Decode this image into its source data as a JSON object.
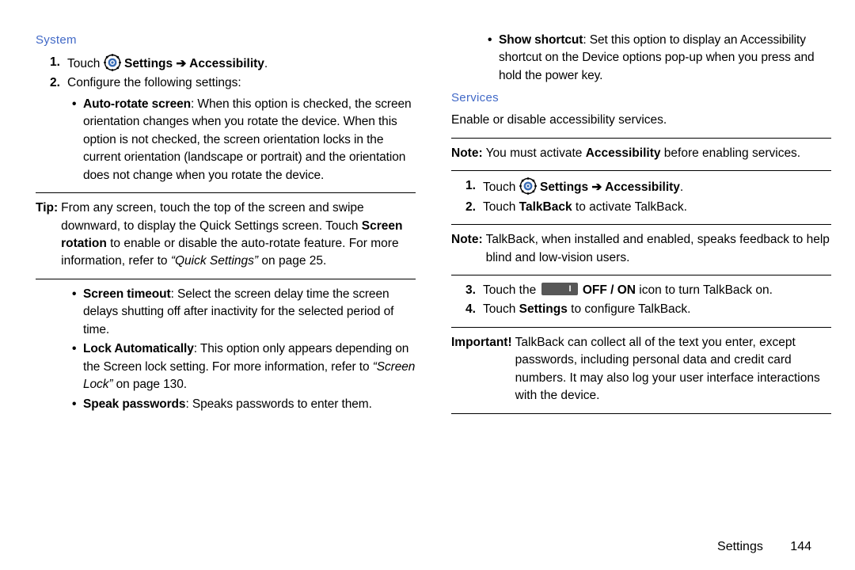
{
  "left": {
    "heading": "System",
    "step1_prefix": "Touch ",
    "step1_suffix": " Settings ➔ Accessibility",
    "step2": "Configure the following settings:",
    "auto_rotate_label": "Auto-rotate screen",
    "auto_rotate_text": ": When this option is checked, the screen orientation changes when you rotate the device. When this option is not checked, the screen orientation locks in the current orientation (landscape or portrait) and the orientation does not change when you rotate the device.",
    "tip_label": "Tip:",
    "tip_text1": " From any screen, touch the top of the screen and swipe downward, to display the Quick Settings screen. Touch ",
    "tip_bold": "Screen rotation",
    "tip_text2": " to enable or disable the auto-rotate feature. For more information, refer to ",
    "tip_italic": "“Quick Settings”",
    "tip_text3": " on page 25.",
    "screen_timeout_label": "Screen timeout",
    "screen_timeout_text": ": Select the screen delay time the screen delays shutting off after inactivity for the selected period of time.",
    "lock_auto_label": "Lock Automatically",
    "lock_auto_text": ": This option only appears depending on the Screen lock setting. For more information, refer to ",
    "lock_auto_italic": "“Screen Lock”",
    "lock_auto_text2": " on page 130.",
    "speak_pw_label": "Speak passwords",
    "speak_pw_text": ": Speaks passwords to enter them."
  },
  "right": {
    "show_shortcut_label": "Show shortcut",
    "show_shortcut_text": ": Set this option to display an Accessibility shortcut on the Device options pop-up when you press and hold the power key.",
    "heading": "Services",
    "intro": "Enable or disable accessibility services.",
    "note1_label": "Note:",
    "note1_text1": " You must activate ",
    "note1_bold": "Accessibility",
    "note1_text2": " before enabling services.",
    "step1_prefix": "Touch ",
    "step1_suffix": " Settings ➔ Accessibility",
    "step2_prefix": "Touch ",
    "step2_bold": "TalkBack",
    "step2_suffix": " to activate TalkBack.",
    "note2_label": "Note:",
    "note2_text": " TalkBack, when installed and enabled, speaks feedback to help blind and low-vision users.",
    "step3_prefix": "Touch the ",
    "step3_bold": " OFF / ON",
    "step3_suffix": " icon to turn TalkBack on.",
    "step4_prefix": "Touch ",
    "step4_bold": "Settings",
    "step4_suffix": " to configure TalkBack.",
    "important_label": "Important!",
    "important_text": " TalkBack can collect all of the text you enter, except passwords, including personal data and credit card numbers. It may also log your user interface interactions with the device."
  },
  "footer": {
    "section": "Settings",
    "page": "144"
  }
}
